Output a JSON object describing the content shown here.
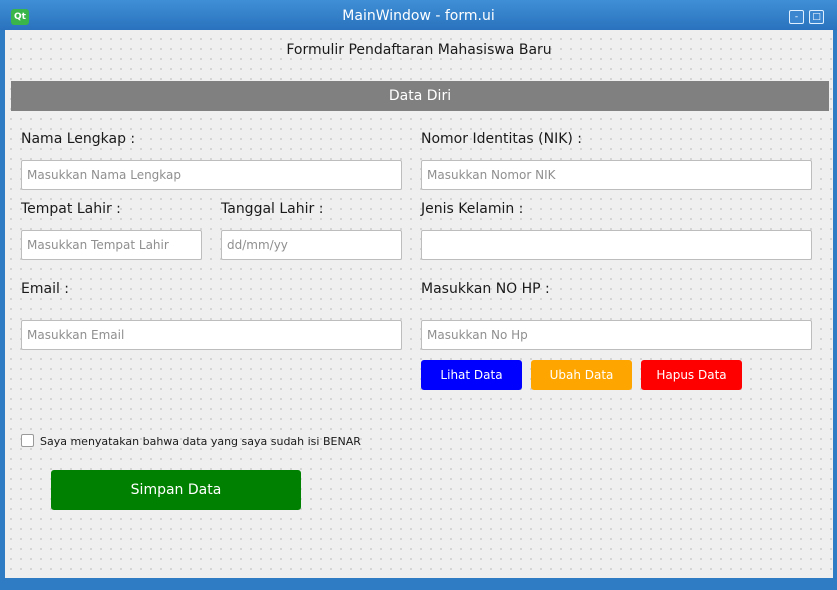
{
  "window": {
    "title": "MainWindow - form.ui",
    "app_icon_text": "Qt",
    "minimize_symbol": "-",
    "maximize_symbol": "□"
  },
  "form": {
    "title": "Formulir Pendaftaran Mahasiswa Baru",
    "section_title": "Data Diri"
  },
  "fields": {
    "nama": {
      "label": "Nama Lengkap :",
      "placeholder": "Masukkan Nama Lengkap",
      "value": ""
    },
    "nik": {
      "label": "Nomor  Identitas (NIK) :",
      "placeholder": "Masukkan Nomor NIK",
      "value": ""
    },
    "tempat_lahir": {
      "label": "Tempat Lahir :",
      "placeholder": "Masukkan Tempat Lahir",
      "value": ""
    },
    "tanggal_lahir": {
      "label": "Tanggal Lahir :",
      "placeholder": "dd/mm/yy",
      "value": ""
    },
    "jenis_kelamin": {
      "label": "Jenis Kelamin :",
      "placeholder": "",
      "value": ""
    },
    "email": {
      "label": "Email :",
      "placeholder": "Masukkan Email",
      "value": ""
    },
    "no_hp": {
      "label": "Masukkan NO HP :",
      "placeholder": "Masukkan No Hp",
      "value": ""
    }
  },
  "buttons": {
    "lihat": {
      "label": "Lihat Data",
      "color": "#0000ff"
    },
    "ubah": {
      "label": "Ubah Data",
      "color": "#ffa500"
    },
    "hapus": {
      "label": "Hapus Data",
      "color": "#ff0000"
    },
    "simpan": {
      "label": "Simpan Data",
      "color": "#008000"
    }
  },
  "agreement": {
    "label": "Saya menyatakan bahwa data yang saya sudah isi  BENAR",
    "checked": false
  },
  "colors": {
    "titlebar": "#2f7cc4",
    "section_bar": "#808080",
    "background": "#efefef"
  }
}
